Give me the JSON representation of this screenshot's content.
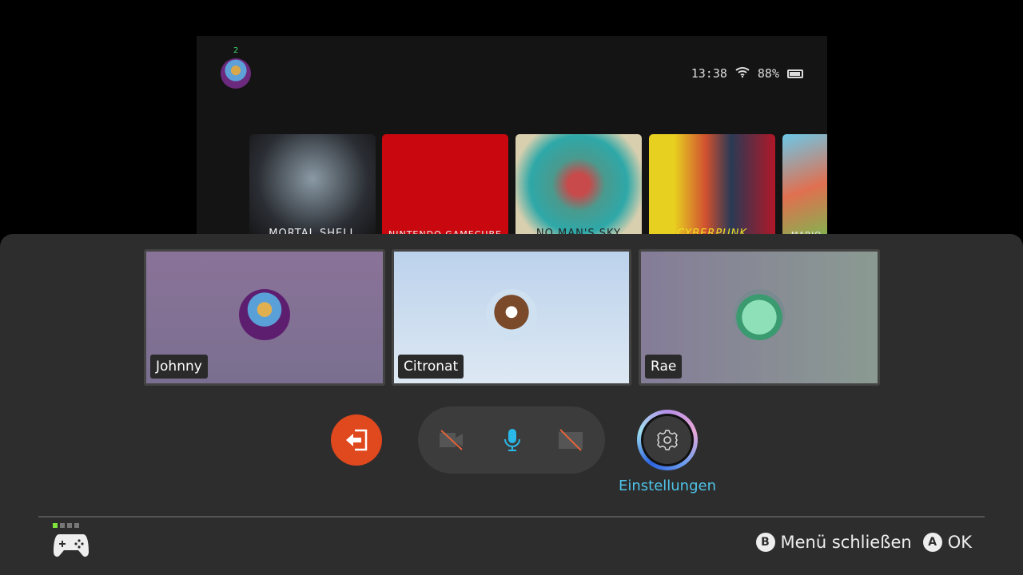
{
  "home": {
    "user_count": "2",
    "time": "13:38",
    "battery": "88%",
    "games": [
      {
        "title": "MORTAL SHELL"
      },
      {
        "title": "NINTENDO GAMECUBE"
      },
      {
        "title": "NO MAN'S SKY"
      },
      {
        "title": "CYBERPUNK"
      },
      {
        "title": "MARIO"
      }
    ]
  },
  "participants": [
    {
      "name": "Johnny"
    },
    {
      "name": "Citronat"
    },
    {
      "name": "Rae"
    }
  ],
  "controls": {
    "settings_label": "Einstellungen"
  },
  "footer": {
    "b_key": "B",
    "close_label": "Menü schließen",
    "a_key": "A",
    "ok_label": "OK"
  }
}
